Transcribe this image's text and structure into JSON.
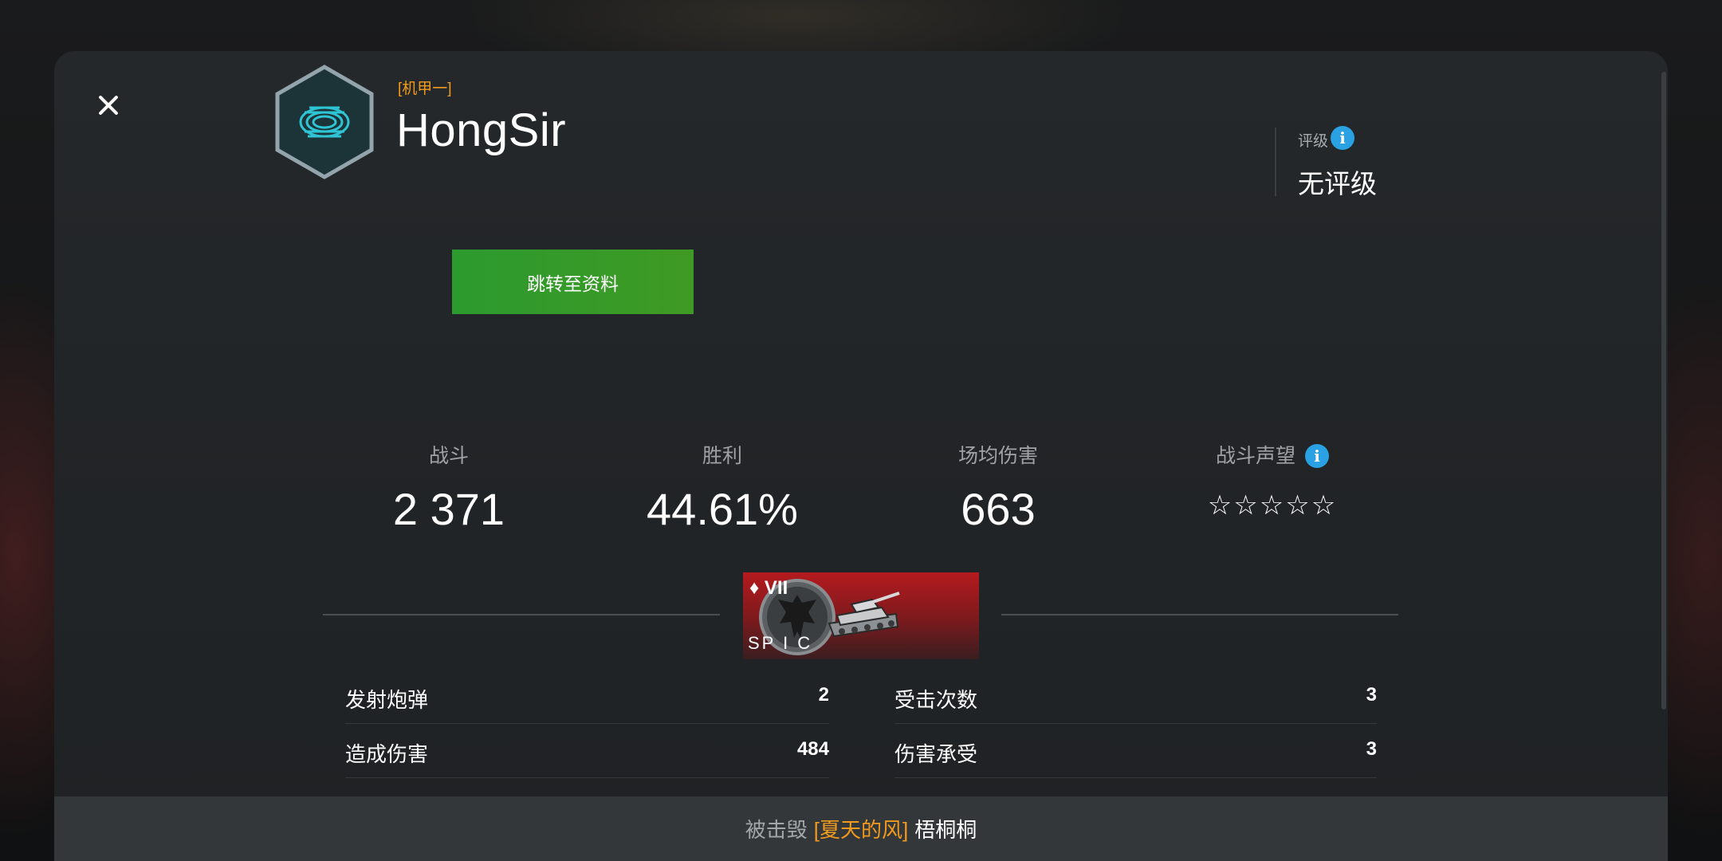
{
  "player": {
    "clan_tag": "[机甲一]",
    "name": "HongSir",
    "profile_button": "跳转至资料"
  },
  "rating": {
    "label": "评级",
    "value": "无评级"
  },
  "stats": {
    "battles": {
      "label": "战斗",
      "value": "2 371"
    },
    "wins": {
      "label": "胜利",
      "value": "44.61%"
    },
    "avg_damage": {
      "label": "场均伤害",
      "value": "663"
    },
    "reputation": {
      "label": "战斗声望",
      "stars": "☆☆☆☆☆",
      "stars_filled": 0,
      "stars_total": 5
    }
  },
  "tank": {
    "tier": "♦ VII",
    "name": "SP I C"
  },
  "battle_stats": {
    "left": [
      {
        "label": "发射炮弹",
        "value": "2"
      },
      {
        "label": "造成伤害",
        "value": "484"
      }
    ],
    "right": [
      {
        "label": "受击次数",
        "value": "3"
      },
      {
        "label": "伤害承受",
        "value": "3"
      }
    ]
  },
  "footer": {
    "prefix": "被击毁",
    "killer_clan": "[夏天的风]",
    "killer_name": "梧桐桐"
  },
  "colors": {
    "accent_orange": "#f29a1d",
    "button_green": "#3a9a29",
    "info_blue": "#2aa1e2",
    "tank_card_red": "#b41a1e"
  },
  "icons": [
    "close-icon",
    "clan-emblem-icon",
    "info-icon",
    "nation-eagle-icon",
    "tank-icon",
    "star-outline-icon"
  ]
}
